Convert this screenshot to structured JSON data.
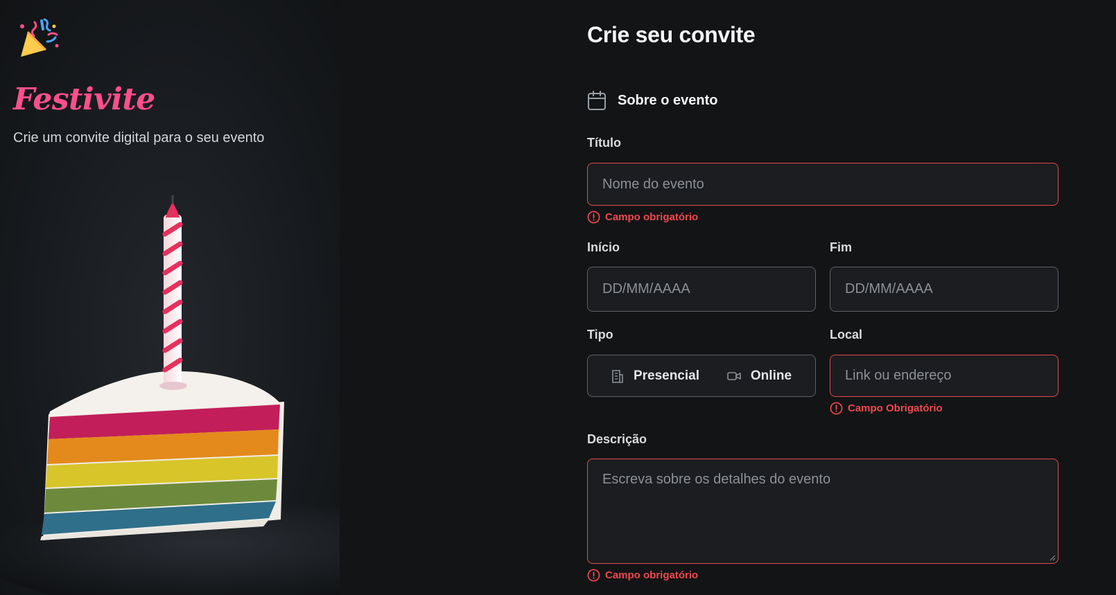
{
  "brand": {
    "logo_icon": "party-popper-icon",
    "name": "Festivite",
    "tagline": "Crie um convite digital para o seu evento"
  },
  "hero": {
    "image": "birthday-cake-slice-with-candle"
  },
  "form": {
    "title": "Crie seu convite",
    "section": {
      "icon": "calendar-icon",
      "title": "Sobre o evento"
    },
    "titulo": {
      "label": "Título",
      "placeholder": "Nome do evento",
      "value": "",
      "error": "Campo obrigatório"
    },
    "inicio": {
      "label": "Início",
      "placeholder": "DD/MM/AAAA",
      "value": ""
    },
    "fim": {
      "label": "Fim",
      "placeholder": "DD/MM/AAAA",
      "value": ""
    },
    "tipo": {
      "label": "Tipo",
      "options": [
        {
          "icon": "building-icon",
          "label": "Presencial"
        },
        {
          "icon": "video-camera-icon",
          "label": "Online"
        }
      ]
    },
    "local": {
      "label": "Local",
      "placeholder": "Link ou endereço",
      "value": "",
      "error": "Campo Obrigatório"
    },
    "descricao": {
      "label": "Descrição",
      "placeholder": "Escreva sobre os detalhes do evento",
      "value": "",
      "error": "Campo obrigatório"
    }
  },
  "colors": {
    "background": "#131416",
    "brand_pink": "#ff4f8b",
    "error_red": "#f0484e",
    "input_border": "#5c6066",
    "input_bg": "#1b1d20"
  }
}
